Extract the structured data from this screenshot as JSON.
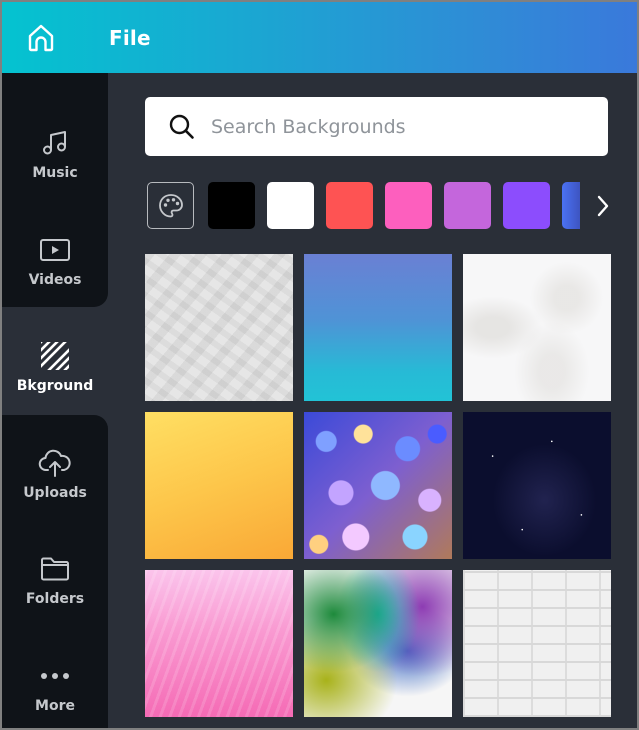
{
  "header": {
    "home_icon": "home-icon",
    "file_label": "File"
  },
  "sidebar": {
    "items": [
      {
        "label": "Music",
        "icon": "music-note-icon",
        "active": false
      },
      {
        "label": "Videos",
        "icon": "video-play-icon",
        "active": false
      },
      {
        "label": "Bkground",
        "icon": "background-stripes-icon",
        "active": true
      },
      {
        "label": "Uploads",
        "icon": "cloud-upload-icon",
        "active": false
      },
      {
        "label": "Folders",
        "icon": "folder-icon",
        "active": false
      },
      {
        "label": "More",
        "icon": "more-dots-icon",
        "active": false
      }
    ]
  },
  "search": {
    "placeholder": "Search Backgrounds",
    "value": ""
  },
  "color_swatches": {
    "palette_icon": "palette-icon",
    "colors": [
      "#000000",
      "#ffffff",
      "#fe5353",
      "#fd5fbe",
      "#c466dc",
      "#8c4dfd",
      "#4b72f4"
    ],
    "next_icon": "chevron-right-icon"
  },
  "backgrounds": [
    {
      "name": "crumpled-paper"
    },
    {
      "name": "blue-teal-gradient"
    },
    {
      "name": "white-marble"
    },
    {
      "name": "yellow-orange-gradient"
    },
    {
      "name": "bokeh-lights"
    },
    {
      "name": "night-sky-stars"
    },
    {
      "name": "pink-fur"
    },
    {
      "name": "rainbow-smoke"
    },
    {
      "name": "white-brick-wall"
    }
  ]
}
